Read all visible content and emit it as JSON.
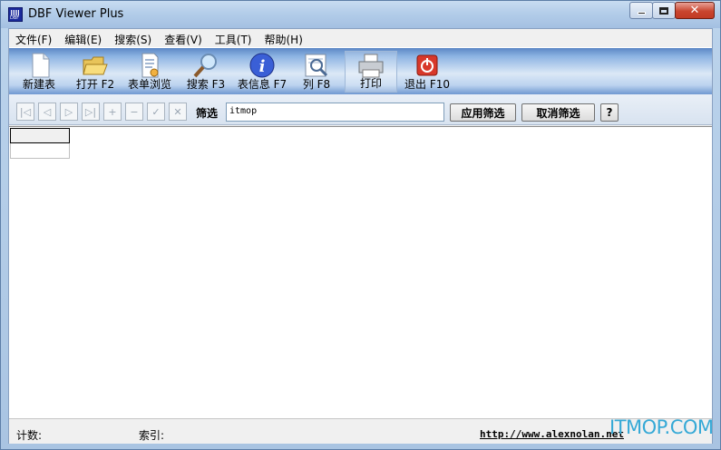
{
  "window": {
    "title": "DBF Viewer Plus",
    "app_icon_text": "DBF",
    "close_glyph": "✕"
  },
  "menu": [
    {
      "label": "文件(F)"
    },
    {
      "label": "编辑(E)"
    },
    {
      "label": "搜索(S)"
    },
    {
      "label": "查看(V)"
    },
    {
      "label": "工具(T)"
    },
    {
      "label": "帮助(H)"
    }
  ],
  "toolbar": {
    "new_table": "新建表",
    "open": "打开 F2",
    "browse": "表单浏览",
    "search": "搜索 F3",
    "table_info": "表信息 F7",
    "columns": "列 F8",
    "print": "打印",
    "exit": "退出 F10",
    "info_glyph": "i"
  },
  "filter": {
    "label": "筛选",
    "value": "itmop",
    "apply_label": "应用筛选",
    "cancel_label": "取消筛选",
    "help_label": "?"
  },
  "nav_buttons": [
    {
      "name": "nav-first-icon",
      "glyph": "|◁"
    },
    {
      "name": "nav-prev-icon",
      "glyph": "◁"
    },
    {
      "name": "nav-next-icon",
      "glyph": "▷"
    },
    {
      "name": "nav-last-icon",
      "glyph": "▷|"
    },
    {
      "name": "nav-insert-icon",
      "glyph": "+"
    },
    {
      "name": "nav-delete-icon",
      "glyph": "−"
    },
    {
      "name": "nav-edit-icon",
      "glyph": "✓"
    },
    {
      "name": "nav-cancel-icon",
      "glyph": "✕"
    }
  ],
  "status": {
    "count_label": "计数:",
    "index_label": "索引:",
    "link": "http://www.alexnolan.net"
  },
  "watermark": "ITMOP.COM",
  "colors": {
    "toolbar_blue": "#5b86c5",
    "close_red": "#c9452f",
    "watermark": "#35a9d6"
  }
}
